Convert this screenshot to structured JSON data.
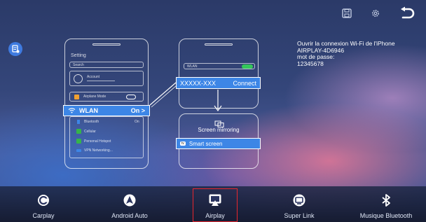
{
  "screen": {
    "accent": "#3d86e6",
    "active_outline": "#e8262d"
  },
  "topbar": {
    "icons": [
      "save-icon",
      "gear-icon",
      "back-arrow-icon"
    ]
  },
  "guide": {
    "phone1": {
      "title": "Setting",
      "search": "Search",
      "account": "Account",
      "airplane": "Airplane Mode",
      "wlan_label": "WLAN",
      "wlan_value": "On >",
      "bluetooth": "Bluetooth",
      "bluetooth_value": "On",
      "cellular": "Cellular",
      "hotspot": "Personal Hotspot",
      "vpn": "VPN Networking..."
    },
    "phone2": {
      "wlan": "WLAN",
      "network": "XXXXX-XXX",
      "connect": "Connect"
    },
    "phone3": {
      "mirroring": "Screen mirroring",
      "tv_badge": "tv",
      "smart": "Smart screen"
    }
  },
  "wifi_info": {
    "line1": "Ouvrir la connexion Wi-Fi de l'iPhone",
    "line2": "AIRPLAY-4D6946",
    "line3": "mot de passe:",
    "line4": "12345678"
  },
  "nav": {
    "items": [
      {
        "label": "Carplay",
        "icon": "carplay-icon"
      },
      {
        "label": "Android Auto",
        "icon": "android-auto-icon"
      },
      {
        "label": "Airplay",
        "icon": "airplay-icon",
        "active": true
      },
      {
        "label": "Super Link",
        "icon": "super-link-icon"
      },
      {
        "label": "Musique Bluetooth",
        "icon": "bluetooth-icon"
      }
    ]
  }
}
